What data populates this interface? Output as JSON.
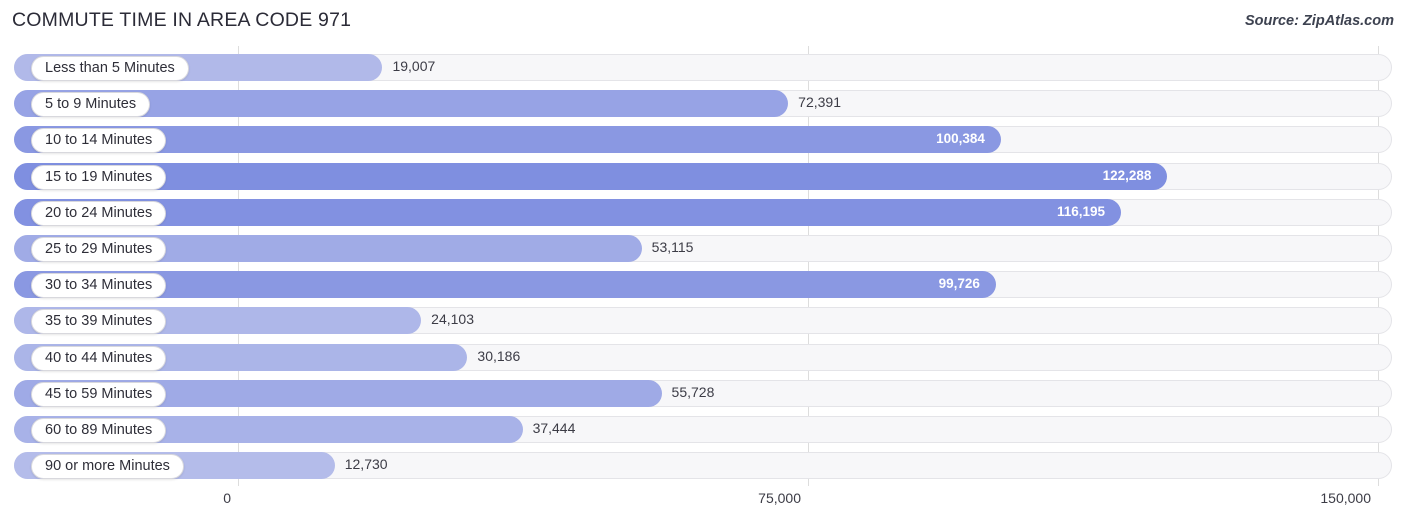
{
  "header": {
    "title": "COMMUTE TIME IN AREA CODE 971",
    "source": "Source: ZipAtlas.com"
  },
  "colors": {
    "bar_light": "#b4bcea",
    "bar_dark": "#7f8fe0",
    "track_fill": "#f7f7f9",
    "track_border": "#e4e4e8",
    "gridline": "#dddddd",
    "label_text": "#3c3c46",
    "inside_label_text": "#ffffff",
    "title_text": "#2b2b37"
  },
  "chart_data": {
    "type": "bar",
    "orientation": "horizontal",
    "title": "COMMUTE TIME IN AREA CODE 971",
    "xlabel": "",
    "ylabel": "",
    "xlim": [
      0,
      150000
    ],
    "grid": true,
    "legend": false,
    "axis_ticks": [
      "0",
      "75,000",
      "150,000"
    ],
    "axis_tick_values": [
      0,
      75000,
      150000
    ],
    "categories": [
      "Less than 5 Minutes",
      "5 to 9 Minutes",
      "10 to 14 Minutes",
      "15 to 19 Minutes",
      "20 to 24 Minutes",
      "25 to 29 Minutes",
      "30 to 34 Minutes",
      "35 to 39 Minutes",
      "40 to 44 Minutes",
      "45 to 59 Minutes",
      "60 to 89 Minutes",
      "90 or more Minutes"
    ],
    "values": [
      19007,
      72391,
      100384,
      122288,
      116195,
      53115,
      99726,
      24103,
      30186,
      55728,
      37444,
      12730
    ],
    "value_labels": [
      "19,007",
      "72,391",
      "100,384",
      "122,288",
      "116,195",
      "53,115",
      "99,726",
      "24,103",
      "30,186",
      "55,728",
      "37,444",
      "12,730"
    ],
    "label_placement": [
      "outside",
      "outside",
      "inside",
      "inside",
      "inside",
      "outside",
      "inside",
      "outside",
      "outside",
      "outside",
      "outside",
      "outside"
    ]
  }
}
